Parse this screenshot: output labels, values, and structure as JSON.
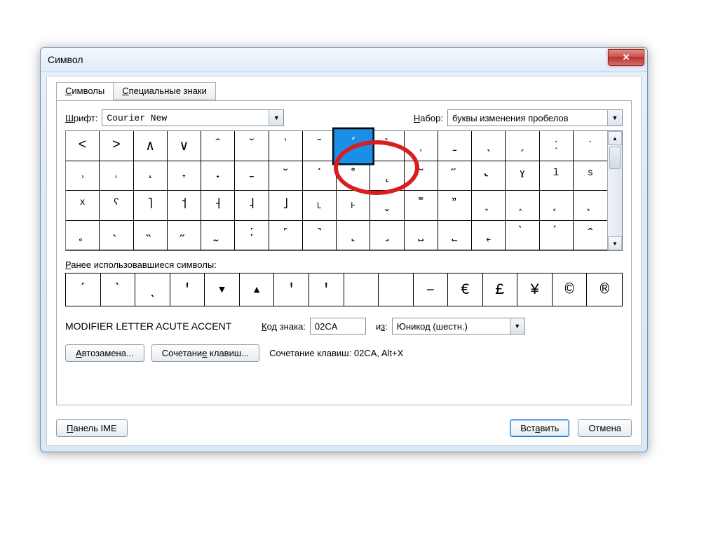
{
  "window": {
    "title": "Символ"
  },
  "tabs": {
    "symbols": "Символы",
    "special": "Специальные знаки"
  },
  "font": {
    "label": "Шрифт:",
    "value": "Courier New"
  },
  "subset": {
    "label": "Набор:",
    "value": "буквы изменения пробелов"
  },
  "grid": {
    "symbols": [
      "<",
      ">",
      "∧",
      "∨",
      "ˆ",
      "ˇ",
      "ˈ",
      "ˉ",
      "ˊ",
      "ˋ",
      "ˌ",
      "ˍ",
      "ˎ",
      "ˏ",
      "ː",
      "ˑ",
      "˒",
      "˓",
      "˔",
      "˕",
      "˖",
      "˗",
      "˘",
      "˙",
      "˚",
      "˛",
      "˜",
      "˝",
      "˞",
      "ˠ",
      "ˡ",
      "ˢ",
      "ˣ",
      "ˤ",
      "˥",
      "˦",
      "˧",
      "˨",
      "˩",
      "˪",
      "˫",
      "ˬ",
      "˭",
      "ˮ",
      "˯",
      "˰",
      "˱",
      "˲",
      "˳",
      "˴",
      "˵",
      "˶",
      "˷",
      "˸",
      "˹",
      "˺",
      "˻",
      "˼",
      "˽",
      "˾",
      "˿",
      "̀",
      "́",
      "̂"
    ],
    "selected_index": 8
  },
  "recent": {
    "label": "Ранее использовавшиеся символы:",
    "symbols": [
      "ˊ",
      "ˋ",
      "ˎ",
      "'",
      "▾",
      "▴",
      "'",
      "'",
      "",
      "",
      "–",
      "€",
      "£",
      "¥",
      "©",
      "®"
    ]
  },
  "char_name": "MODIFIER LETTER ACUTE ACCENT",
  "code": {
    "label": "Код знака:",
    "value": "02CA"
  },
  "from": {
    "label": "из:",
    "value": "Юникод (шестн.)"
  },
  "autocorrect": "Автозамена...",
  "shortcut_key": "Сочетание клавиш...",
  "shortcut_info": {
    "label": "Сочетание клавиш:",
    "value": "02CA, Alt+X"
  },
  "footer": {
    "ime": "Панель IME",
    "insert": "Вставить",
    "cancel": "Отмена"
  }
}
